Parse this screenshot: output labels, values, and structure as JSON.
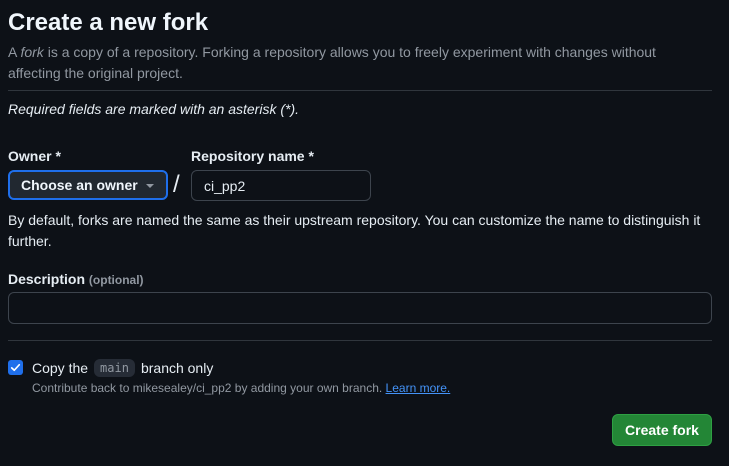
{
  "page": {
    "title": "Create a new fork",
    "intro_prefix": "A ",
    "intro_em": "fork",
    "intro_rest": " is a copy of a repository. Forking a repository allows you to freely experiment with changes without affecting the original project.",
    "required_note": "Required fields are marked with an asterisk (*)."
  },
  "owner": {
    "label": "Owner *",
    "button_label": "Choose an owner"
  },
  "separator": "/",
  "repo": {
    "label": "Repository name *",
    "value": "ci_pp2",
    "hint": "By default, forks are named the same as their upstream repository. You can customize the name to distinguish it further."
  },
  "description": {
    "label": "Description",
    "optional": "(optional)",
    "value": ""
  },
  "copy_branch": {
    "checked": true,
    "label_before": "Copy the",
    "branch": "main",
    "label_after": "branch only",
    "contribute_text": "Contribute back to mikesealey/ci_pp2 by adding your own branch.",
    "learn_more": "Learn more."
  },
  "actions": {
    "create_label": "Create fork"
  },
  "colors": {
    "background": "#0d1117",
    "accent_blue": "#1f6feb",
    "create_green": "#238636",
    "link": "#4493f8"
  }
}
